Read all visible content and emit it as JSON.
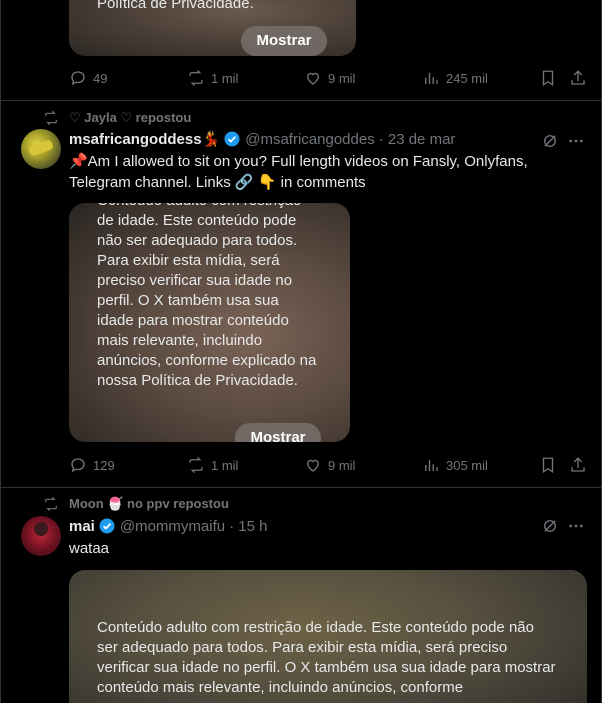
{
  "posts": [
    {
      "media": {
        "text_tail": "Política de Privacidade.",
        "show_label": "Mostrar"
      },
      "actions": {
        "replies": "49",
        "reposts": "1 mil",
        "likes": "9 mil",
        "views": "245 mil"
      }
    },
    {
      "repost_by": "♡ Jayla ♡ repostou",
      "author": {
        "name": "msafricangoddess💃",
        "handle": "@msafricangoddes",
        "date": "· 23 de mar"
      },
      "text": "📌Am I allowed to sit on you? Full length videos on Fansly, Onlyfans, Telegram channel. Links 🔗 👇 in comments",
      "media": {
        "text": "Conteúdo adulto com restrição de idade. Este conteúdo pode não ser adequado para todos. Para exibir esta mídia, será preciso verificar sua idade no perfil. O X também usa sua idade para mostrar conteúdo mais relevante, incluindo anúncios, conforme explicado na nossa Política de Privacidade.",
        "show_label": "Mostrar"
      },
      "actions": {
        "replies": "129",
        "reposts": "1 mil",
        "likes": "9 mil",
        "views": "305 mil"
      }
    },
    {
      "repost_by": "Moon 🍧 no ppv repostou",
      "author": {
        "name": "mai",
        "handle": "@mommymaifu",
        "date": "· 15 h"
      },
      "text": "wataa",
      "media": {
        "text": "Conteúdo adulto com restrição de idade. Este conteúdo pode não ser adequado para todos. Para exibir esta mídia, será preciso verificar sua idade no perfil. O X também usa sua idade para mostrar conteúdo mais relevante, incluindo anúncios, conforme"
      }
    }
  ],
  "colors": {
    "background": "#000000",
    "text": "#e7e9ea",
    "muted": "#71767b",
    "border": "#2f3336",
    "verified": "#1d9bf0"
  },
  "icons": [
    "reply-icon",
    "repost-icon",
    "like-icon",
    "views-icon",
    "bookmark-icon",
    "share-icon",
    "grok-icon",
    "more-icon",
    "verified-icon"
  ]
}
